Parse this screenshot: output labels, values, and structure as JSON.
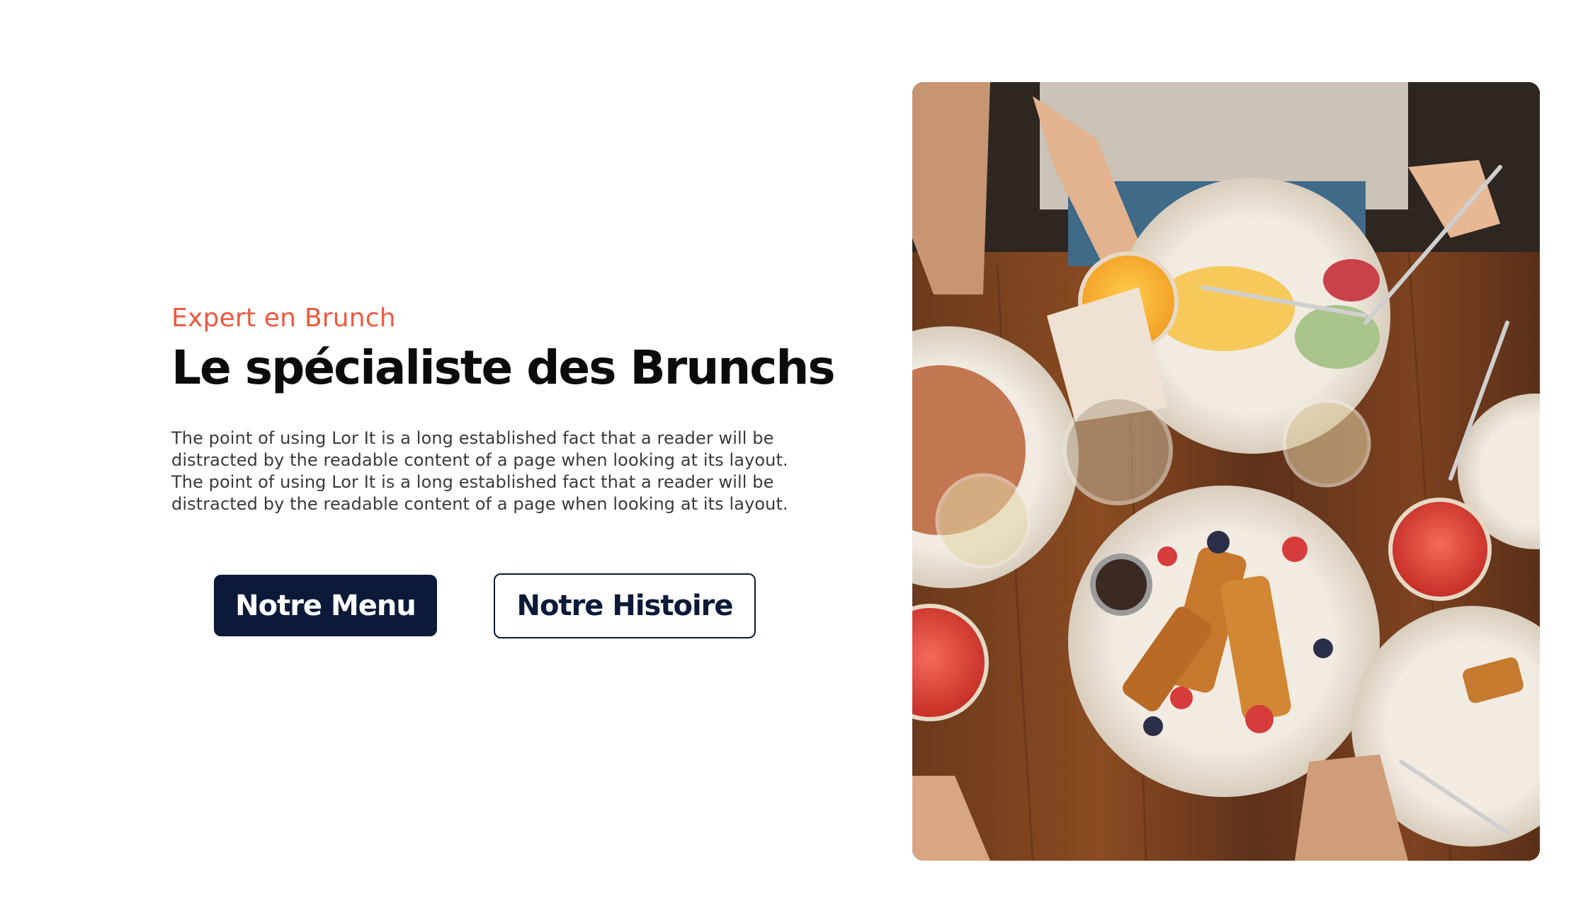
{
  "hero": {
    "eyebrow": "Expert en Brunch",
    "title": "Le spécialiste des Brunchs",
    "description_lines": [
      "The point of using Lor It is a long established fact that a reader will be",
      "distracted by the readable content of a page when looking at its layout.",
      "The point of using Lor It is a long established fact that a reader will be",
      "distracted by the readable content of a page when looking at its layout."
    ],
    "primary_button": "Notre Menu",
    "secondary_button": "Notre Histoire"
  },
  "image": {
    "icon": "brunch-table-photo"
  },
  "colors": {
    "accent": "#f0583f",
    "primary": "#0b1a38",
    "text": "#0b0b0b",
    "muted": "#3a3a3a"
  }
}
